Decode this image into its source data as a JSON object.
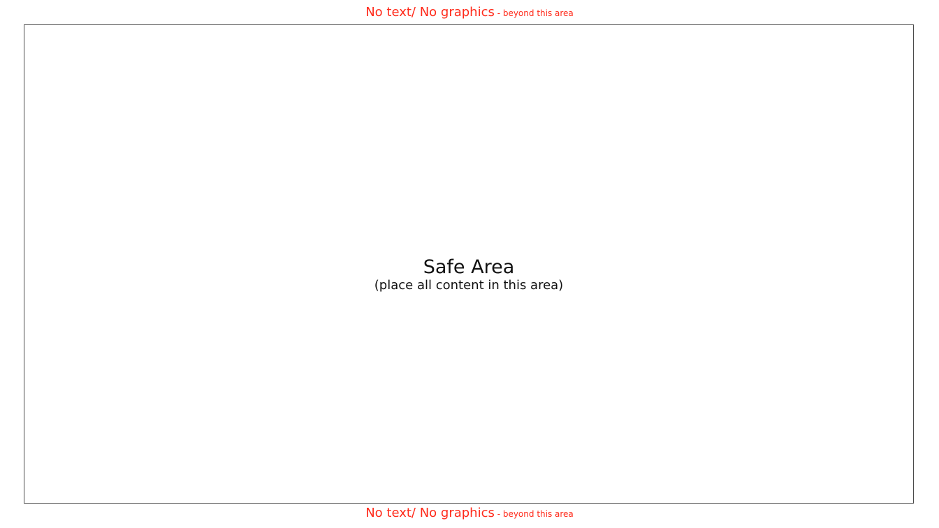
{
  "top_notice": {
    "main": "No text/ No graphics",
    "small": " - beyond this area",
    "color": "#ff2a1a"
  },
  "safe_area": {
    "title": "Safe Area",
    "subtitle": "(place all content in this area)"
  },
  "bottom_notice": {
    "main": "No text/ No graphics",
    "small": " - beyond this area",
    "color": "#ff2a1a"
  }
}
